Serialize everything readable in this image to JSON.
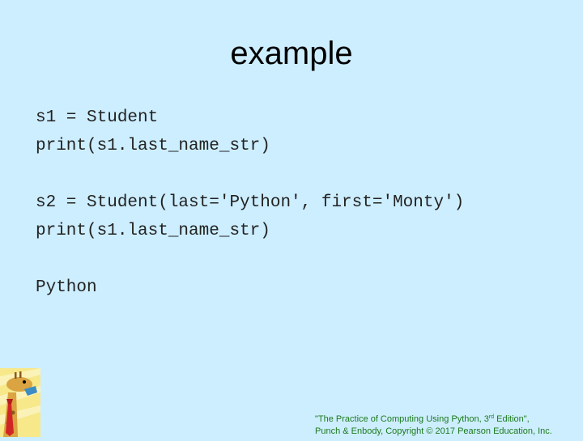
{
  "slide": {
    "title": "example",
    "code_block1": [
      "s1 = Student",
      "print(s1.last_name_str)"
    ],
    "code_block2": [
      "s2 = Student(last='Python', first='Monty')",
      "print(s1.last_name_str)"
    ],
    "output": "Python"
  },
  "footer": {
    "line1_prefix": "\"The Practice of Computing Using Python, 3",
    "line1_sup": "rd",
    "line1_suffix": " Edition\",",
    "line2": "Punch & Enbody, Copyright © 2017 Pearson Education, Inc."
  },
  "colors": {
    "background": "#cdeeff",
    "footer_text": "#1c7a1c",
    "code_text": "#222222"
  },
  "logo": {
    "icon": "giraffe-icon"
  }
}
